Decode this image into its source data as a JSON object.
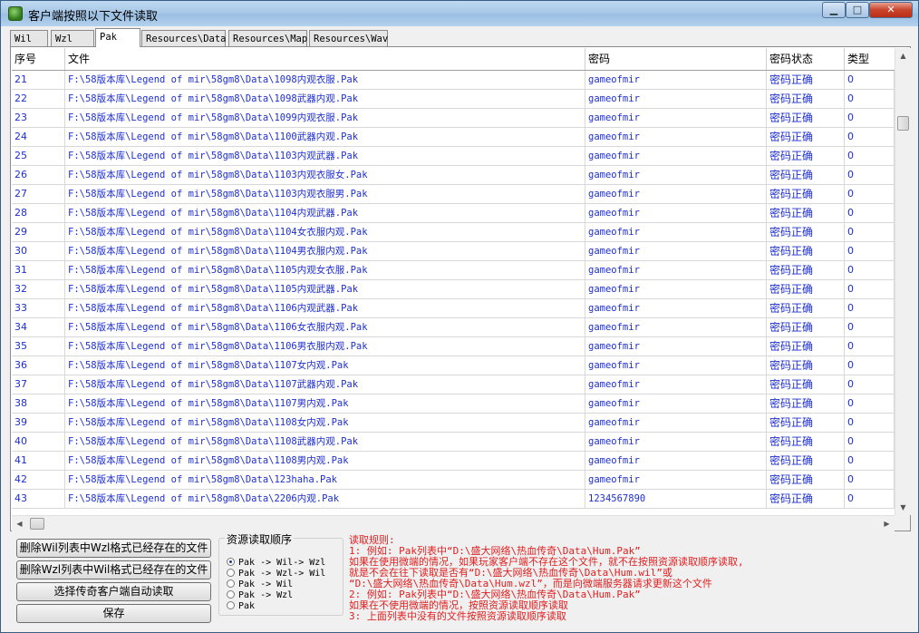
{
  "window": {
    "title": "客户端按照以下文件读取",
    "min_label": "▁",
    "max_label": "□",
    "close_label": "✕"
  },
  "tabs": [
    "Wil",
    "Wzl",
    "Pak",
    "Resources\\Data",
    "Resources\\Map",
    "Resources\\Wav"
  ],
  "active_tab": "Pak",
  "table": {
    "headers": [
      "序号",
      "文件",
      "密码",
      "密码状态",
      "类型"
    ],
    "rows": [
      {
        "idx": "21",
        "file": "F:\\58版本库\\Legend of mir\\58gm8\\Data\\1098内观衣服.Pak",
        "pwd": "gameofmir",
        "status": "密码正确",
        "type": "0"
      },
      {
        "idx": "22",
        "file": "F:\\58版本库\\Legend of mir\\58gm8\\Data\\1098武器内观.Pak",
        "pwd": "gameofmir",
        "status": "密码正确",
        "type": "0"
      },
      {
        "idx": "23",
        "file": "F:\\58版本库\\Legend of mir\\58gm8\\Data\\1099内观衣服.Pak",
        "pwd": "gameofmir",
        "status": "密码正确",
        "type": "0"
      },
      {
        "idx": "24",
        "file": "F:\\58版本库\\Legend of mir\\58gm8\\Data\\1100武器内观.Pak",
        "pwd": "gameofmir",
        "status": "密码正确",
        "type": "0"
      },
      {
        "idx": "25",
        "file": "F:\\58版本库\\Legend of mir\\58gm8\\Data\\1103内观武器.Pak",
        "pwd": "gameofmir",
        "status": "密码正确",
        "type": "0"
      },
      {
        "idx": "26",
        "file": "F:\\58版本库\\Legend of mir\\58gm8\\Data\\1103内观衣服女.Pak",
        "pwd": "gameofmir",
        "status": "密码正确",
        "type": "0"
      },
      {
        "idx": "27",
        "file": "F:\\58版本库\\Legend of mir\\58gm8\\Data\\1103内观衣服男.Pak",
        "pwd": "gameofmir",
        "status": "密码正确",
        "type": "0"
      },
      {
        "idx": "28",
        "file": "F:\\58版本库\\Legend of mir\\58gm8\\Data\\1104内观武器.Pak",
        "pwd": "gameofmir",
        "status": "密码正确",
        "type": "0"
      },
      {
        "idx": "29",
        "file": "F:\\58版本库\\Legend of mir\\58gm8\\Data\\1104女衣服内观.Pak",
        "pwd": "gameofmir",
        "status": "密码正确",
        "type": "0"
      },
      {
        "idx": "30",
        "file": "F:\\58版本库\\Legend of mir\\58gm8\\Data\\1104男衣服内观.Pak",
        "pwd": "gameofmir",
        "status": "密码正确",
        "type": "0"
      },
      {
        "idx": "31",
        "file": "F:\\58版本库\\Legend of mir\\58gm8\\Data\\1105内观女衣服.Pak",
        "pwd": "gameofmir",
        "status": "密码正确",
        "type": "0"
      },
      {
        "idx": "32",
        "file": "F:\\58版本库\\Legend of mir\\58gm8\\Data\\1105内观武器.Pak",
        "pwd": "gameofmir",
        "status": "密码正确",
        "type": "0"
      },
      {
        "idx": "33",
        "file": "F:\\58版本库\\Legend of mir\\58gm8\\Data\\1106内观武器.Pak",
        "pwd": "gameofmir",
        "status": "密码正确",
        "type": "0"
      },
      {
        "idx": "34",
        "file": "F:\\58版本库\\Legend of mir\\58gm8\\Data\\1106女衣服内观.Pak",
        "pwd": "gameofmir",
        "status": "密码正确",
        "type": "0"
      },
      {
        "idx": "35",
        "file": "F:\\58版本库\\Legend of mir\\58gm8\\Data\\1106男衣服内观.Pak",
        "pwd": "gameofmir",
        "status": "密码正确",
        "type": "0"
      },
      {
        "idx": "36",
        "file": "F:\\58版本库\\Legend of mir\\58gm8\\Data\\1107女内观.Pak",
        "pwd": "gameofmir",
        "status": "密码正确",
        "type": "0"
      },
      {
        "idx": "37",
        "file": "F:\\58版本库\\Legend of mir\\58gm8\\Data\\1107武器内观.Pak",
        "pwd": "gameofmir",
        "status": "密码正确",
        "type": "0"
      },
      {
        "idx": "38",
        "file": "F:\\58版本库\\Legend of mir\\58gm8\\Data\\1107男内观.Pak",
        "pwd": "gameofmir",
        "status": "密码正确",
        "type": "0"
      },
      {
        "idx": "39",
        "file": "F:\\58版本库\\Legend of mir\\58gm8\\Data\\1108女内观.Pak",
        "pwd": "gameofmir",
        "status": "密码正确",
        "type": "0"
      },
      {
        "idx": "40",
        "file": "F:\\58版本库\\Legend of mir\\58gm8\\Data\\1108武器内观.Pak",
        "pwd": "gameofmir",
        "status": "密码正确",
        "type": "0"
      },
      {
        "idx": "41",
        "file": "F:\\58版本库\\Legend of mir\\58gm8\\Data\\1108男内观.Pak",
        "pwd": "gameofmir",
        "status": "密码正确",
        "type": "0"
      },
      {
        "idx": "42",
        "file": "F:\\58版本库\\Legend of mir\\58gm8\\Data\\123haha.Pak",
        "pwd": "gameofmir",
        "status": "密码正确",
        "type": "0"
      },
      {
        "idx": "43",
        "file": "F:\\58版本库\\Legend of mir\\58gm8\\Data\\2206内观.Pak",
        "pwd": "1234567890",
        "status": "密码正确",
        "type": "0"
      }
    ]
  },
  "buttons": {
    "delete_wil": "删除Wil列表中Wzl格式已经存在的文件",
    "delete_wzl": "删除Wzl列表中Wil格式已经存在的文件",
    "auto_read": "选择传奇客户端自动读取",
    "save": "保存"
  },
  "read_order": {
    "title": "资源读取顺序",
    "options": [
      "Pak -> Wil-> Wzl",
      "Pak -> Wzl-> Wil",
      "Pak -> Wil",
      "Pak -> Wzl",
      "Pak"
    ],
    "selected": "Pak -> Wil-> Wzl"
  },
  "rules": [
    "读取规则:",
    "1: 例如: Pak列表中“D:\\盛大网络\\热血传奇\\Data\\Hum.Pak”",
    "    如果在使用微端的情况，如果玩家客户端不存在这个文件，就不在按照资源读取顺序读取,",
    "    就是不会在往下读取是否有“D:\\盛大网络\\热血传奇\\Data\\Hum.wil”或",
    "    “D:\\盛大网络\\热血传奇\\Data\\Hum.wzl”，而是向微端服务器请求更新这个文件",
    "2: 例如: Pak列表中“D:\\盛大网络\\热血传奇\\Data\\Hum.Pak”",
    "    如果在不使用微端的情况，按照资源读取顺序读取",
    "3: 上面列表中没有的文件按照资源读取顺序读取"
  ],
  "colors": {
    "link_text": "#1e2fd0",
    "rules_text": "#e02020"
  }
}
